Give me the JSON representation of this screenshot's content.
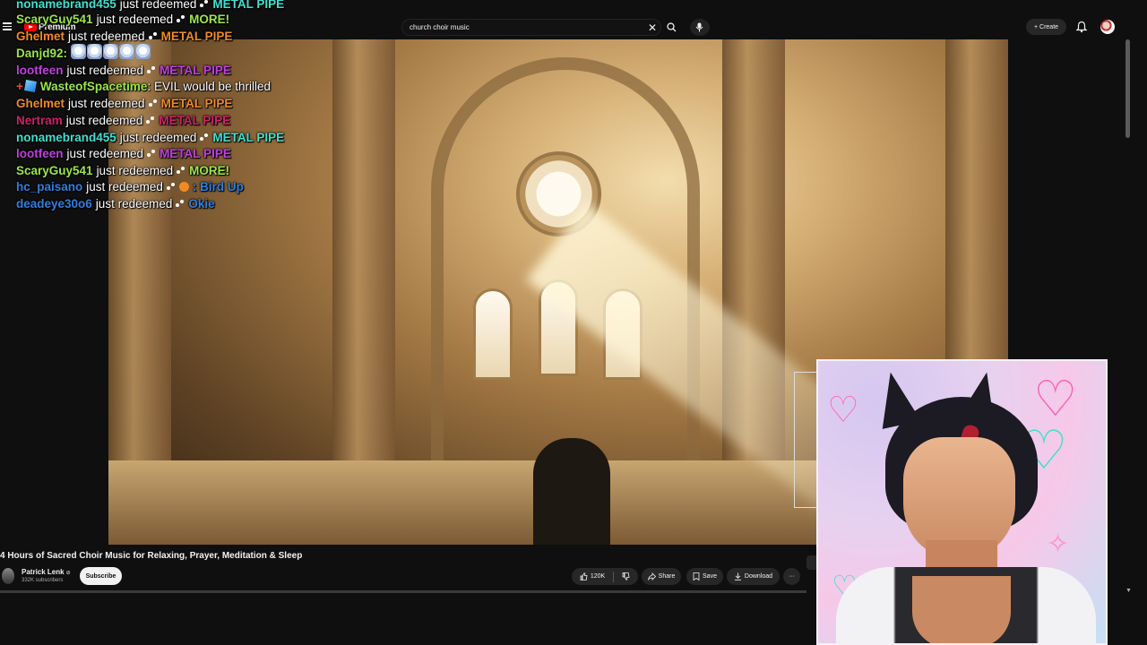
{
  "youtube": {
    "logo_text": "Premium",
    "search": {
      "value": "church choir music",
      "clear_glyph": "✕"
    },
    "create_label": "Create",
    "create_glyph": "+",
    "icons": [
      "menu-icon",
      "youtube-logo-icon",
      "search-icon",
      "mic-icon",
      "bell-icon",
      "avatar-icon"
    ]
  },
  "video": {
    "title": "4 Hours of Sacred Choir Music for Relaxing, Prayer, Meditation & Sleep",
    "channel": "Patrick Lenk",
    "verified_glyph": "⊘",
    "subscribers": "332K subscribers",
    "subscribe_label": "Subscribe",
    "likes": "120K",
    "share_label": "Share",
    "save_label": "Save",
    "download_label": "Download",
    "more_glyph": "···"
  },
  "chat": [
    {
      "user": "nonamebrand455",
      "user_color": "#3fe0d0",
      "message": "just redeemed",
      "reward": "METAL PIPE",
      "reward_color": "#3fe0d0"
    },
    {
      "user": "ScaryGuy541",
      "user_color": "#9ae64a",
      "message": "just redeemed",
      "reward": "MORE!",
      "reward_color": "#9ae64a"
    },
    {
      "user": "Ghelmet",
      "user_color": "#f08a24",
      "message": "just redeemed",
      "reward": "METAL PIPE",
      "reward_color": "#f08a24"
    },
    {
      "user": "Danjd92",
      "user_color": "#9ae64a",
      "message": "",
      "reward": "",
      "reward_color": "#ffffff",
      "emotes": 5
    },
    {
      "user": "lootfeen",
      "user_color": "#c23ee0",
      "message": "just redeemed",
      "reward": "METAL PIPE",
      "reward_color": "#c23ee0"
    },
    {
      "user": "WasteofSpacetime",
      "user_color": "#9ae64a",
      "message": ": EVIL would be thrilled",
      "reward": "",
      "reward_color": "#ffffff",
      "badges": true
    },
    {
      "user": "Ghelmet",
      "user_color": "#f08a24",
      "message": "just redeemed",
      "reward": "METAL PIPE",
      "reward_color": "#f08a24"
    },
    {
      "user": "Nertram",
      "user_color": "#d0206a",
      "message": "just redeemed",
      "reward": "METAL PIPE",
      "reward_color": "#d0206a"
    },
    {
      "user": "nonamebrand455",
      "user_color": "#3fe0d0",
      "message": "just redeemed",
      "reward": "METAL PIPE",
      "reward_color": "#3fe0d0"
    },
    {
      "user": "lootfeen",
      "user_color": "#c23ee0",
      "message": "just redeemed",
      "reward": "METAL PIPE",
      "reward_color": "#c23ee0"
    },
    {
      "user": "ScaryGuy541",
      "user_color": "#9ae64a",
      "message": "just redeemed",
      "reward": "MORE!",
      "reward_color": "#9ae64a"
    },
    {
      "user": "hc_paisano",
      "user_color": "#2e7fe0",
      "message": "just redeemed",
      "reward": ": Bird Up",
      "reward_color": "#2e7fe0",
      "bird": true
    },
    {
      "user": "deadeye30o6",
      "user_color": "#2e7fe0",
      "message": "just redeemed",
      "reward": "Okie",
      "reward_color": "#2e7fe0"
    }
  ]
}
